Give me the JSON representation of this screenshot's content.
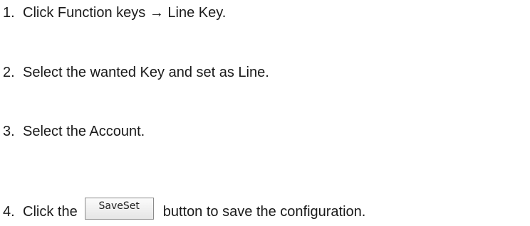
{
  "steps": [
    {
      "number": "1.",
      "text": "Click Function keys → Line Key."
    },
    {
      "number": "2.",
      "text": "Select the wanted Key and set as Line."
    },
    {
      "number": "3.",
      "text": "Select the Account."
    },
    {
      "number": "4.",
      "text_before": "Click the",
      "button_label": "SaveSet",
      "text_after": "button to save the configuration."
    }
  ]
}
